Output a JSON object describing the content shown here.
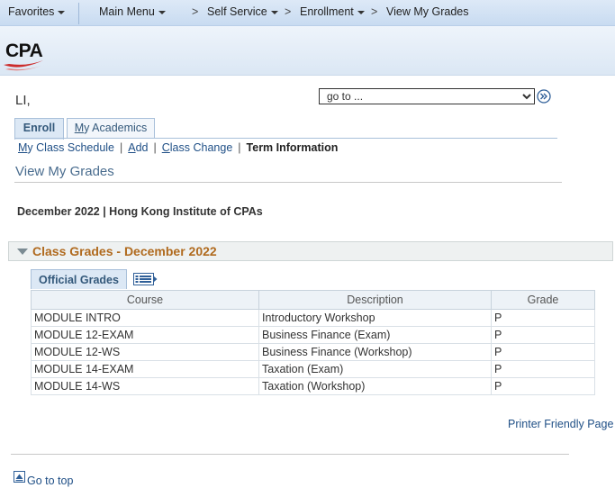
{
  "nav": {
    "favorites": "Favorites",
    "main_menu": "Main Menu",
    "sep": ">",
    "self_service": "Self Service",
    "enrollment": "Enrollment",
    "view_my_grades": "View My Grades"
  },
  "brand": {
    "logo": "CPA"
  },
  "user": {
    "name": "LI,"
  },
  "goto": {
    "selected": "go to ..."
  },
  "tabs": {
    "enroll": "Enroll",
    "academics_prefix": "M",
    "academics_rest": "y Academics"
  },
  "sublinks": {
    "schedule_u": "M",
    "schedule_rest": "y Class Schedule",
    "add_u": "A",
    "add_rest": "dd",
    "change_u": "C",
    "change_rest": "lass Change",
    "term_info": "Term Information",
    "divider": "|"
  },
  "page": {
    "title": "View My Grades",
    "term": "December 2022 | Hong Kong Institute of CPAs"
  },
  "section": {
    "title": "Class Grades - December 2022"
  },
  "grid": {
    "tab": "Official Grades",
    "headers": {
      "course": "Course",
      "description": "Description",
      "grade": "Grade"
    },
    "rows": [
      {
        "course": "MODULE INTRO",
        "description": "Introductory Workshop",
        "grade": "P"
      },
      {
        "course": "MODULE 12-EXAM",
        "description": "Business Finance (Exam)",
        "grade": "P"
      },
      {
        "course": "MODULE 12-WS",
        "description": "Business Finance (Workshop)",
        "grade": "P"
      },
      {
        "course": "MODULE 14-EXAM",
        "description": "Taxation (Exam)",
        "grade": "P"
      },
      {
        "course": "MODULE 14-WS",
        "description": "Taxation (Workshop)",
        "grade": "P"
      }
    ]
  },
  "footer": {
    "printer": "Printer Friendly Page",
    "go_top": "Go to top"
  },
  "icons": {
    "goto": "double-chevron-right-icon",
    "collapse": "triangle-down-icon",
    "grid_view": "grid-view-icon",
    "top": "arrow-up-box-icon"
  },
  "colors": {
    "link": "#1f4f86",
    "section_title": "#b06a1e",
    "nav_bg": "#c8dbf1"
  }
}
